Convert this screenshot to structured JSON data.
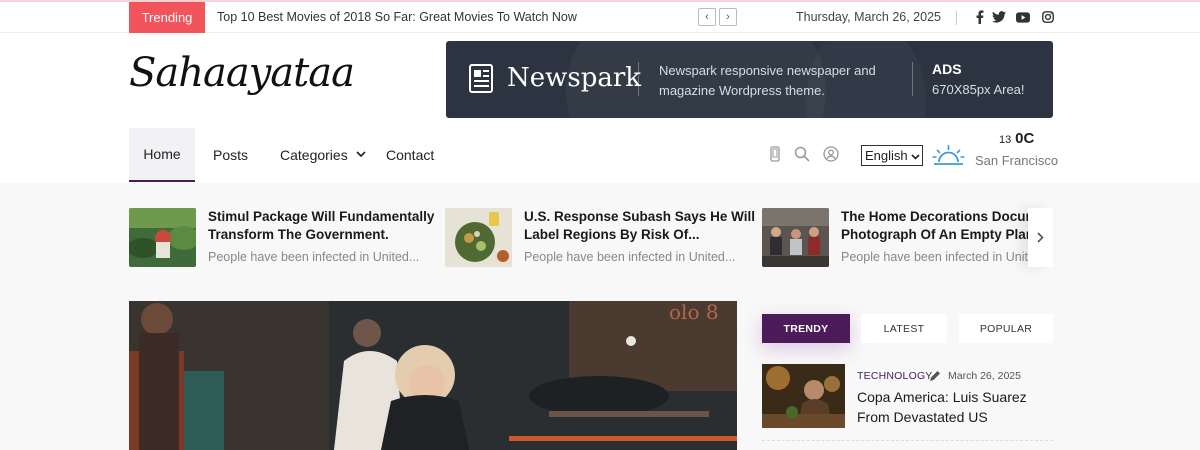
{
  "topbar": {
    "trending_label": "Trending",
    "trending_headline": "Top 10 Best Movies of 2018 So Far: Great Movies To Watch Now",
    "prev_arrow": "‹",
    "next_arrow": "›",
    "date": "Thursday, March 26, 2025",
    "social_icons": [
      "facebook-icon",
      "twitter-icon",
      "youtube-icon",
      "instagram-icon"
    ]
  },
  "header": {
    "logo_text": "Sahaayataa",
    "ad": {
      "brand": "Newspark",
      "description": "Newspark responsive newspaper and magazine Wordpress theme.",
      "title": "ADS",
      "size": "670X85px Area!"
    }
  },
  "nav": {
    "items": [
      {
        "label": "Home",
        "active": true
      },
      {
        "label": "Posts"
      },
      {
        "label": "Categories",
        "dropdown": true
      },
      {
        "label": "Contact"
      }
    ],
    "icons": [
      "mobile-icon",
      "search-icon",
      "user-icon"
    ],
    "language": "English",
    "language_options": [
      "English"
    ],
    "weather": {
      "temp_prefix": "13",
      "temp_unit": "0C",
      "city": "San Francisco"
    }
  },
  "headlines": [
    {
      "title_line1": "Stimul Package Will Fundamentally",
      "title_line2": "Transform The Government.",
      "excerpt": "People have been infected in United..."
    },
    {
      "title_line1": "U.S. Response Subash Says He Will",
      "title_line2": "Label Regions By Risk Of...",
      "excerpt": "People have been infected in United..."
    },
    {
      "title_line1": "The Home Decorations Docume",
      "title_line2": "Photograph Of An Empty Plane",
      "excerpt": "People have been infected in Unite"
    }
  ],
  "sidebar": {
    "tabs": [
      "TRENDY",
      "LATEST",
      "POPULAR"
    ],
    "post": {
      "category": "TECHNOLOGY",
      "date": "March 26, 2025",
      "title": "Copa America: Luis Suarez From Devastated US"
    }
  },
  "colors": {
    "trending_red": "#f2545b",
    "brand_purple": "#4b1b5a",
    "ad_bg": "#2b3440",
    "weather_blue": "#3a9ad9"
  }
}
